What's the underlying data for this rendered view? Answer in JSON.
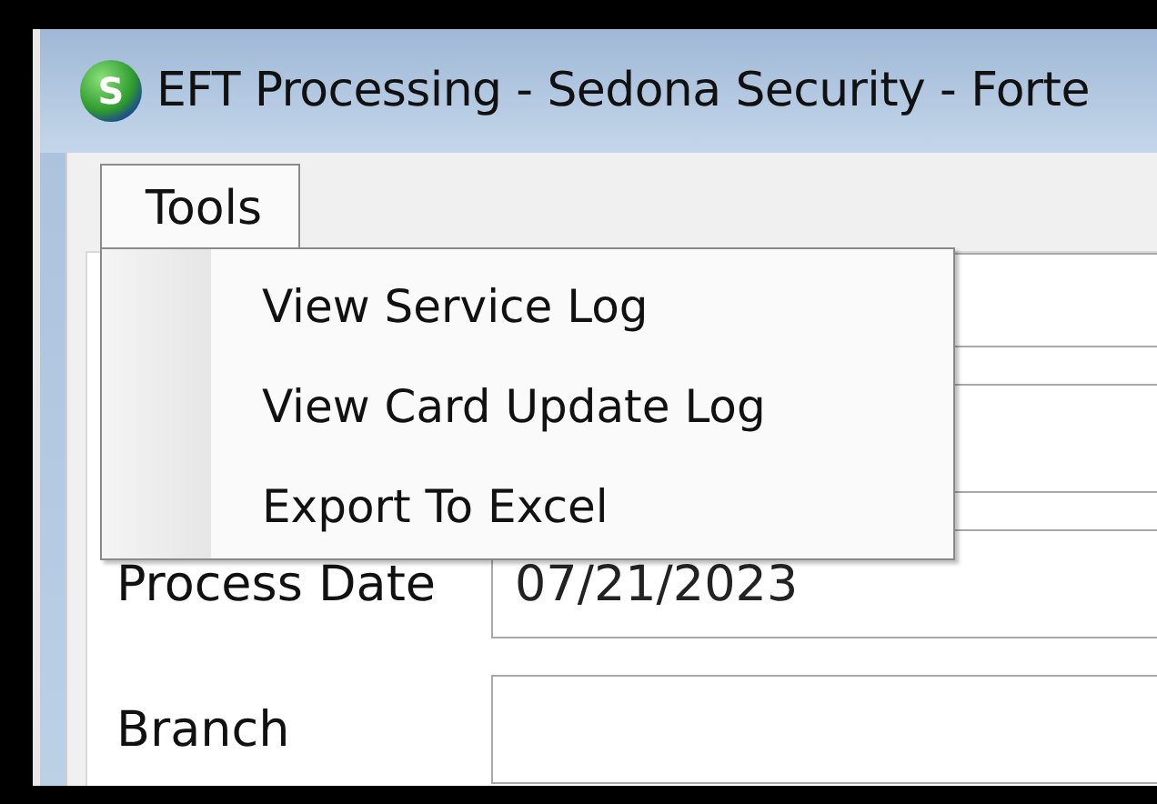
{
  "window": {
    "icon_letter": "S",
    "title": "EFT Processing - Sedona Security - Forte"
  },
  "menu_bar": [
    {
      "label": "Tools",
      "selected": true
    }
  ],
  "menu": {
    "items": [
      {
        "label": "View Service Log"
      },
      {
        "label": "View Card Update Log"
      },
      {
        "label": "Export To Excel"
      }
    ]
  },
  "form": {
    "fields": [
      {
        "kind": "unlabeled"
      },
      {
        "kind": "unlabeled"
      },
      {
        "kind": "labeled",
        "label": "Process Date",
        "value": "07/21/2023"
      },
      {
        "kind": "labeled",
        "label": "Branch"
      }
    ]
  }
}
